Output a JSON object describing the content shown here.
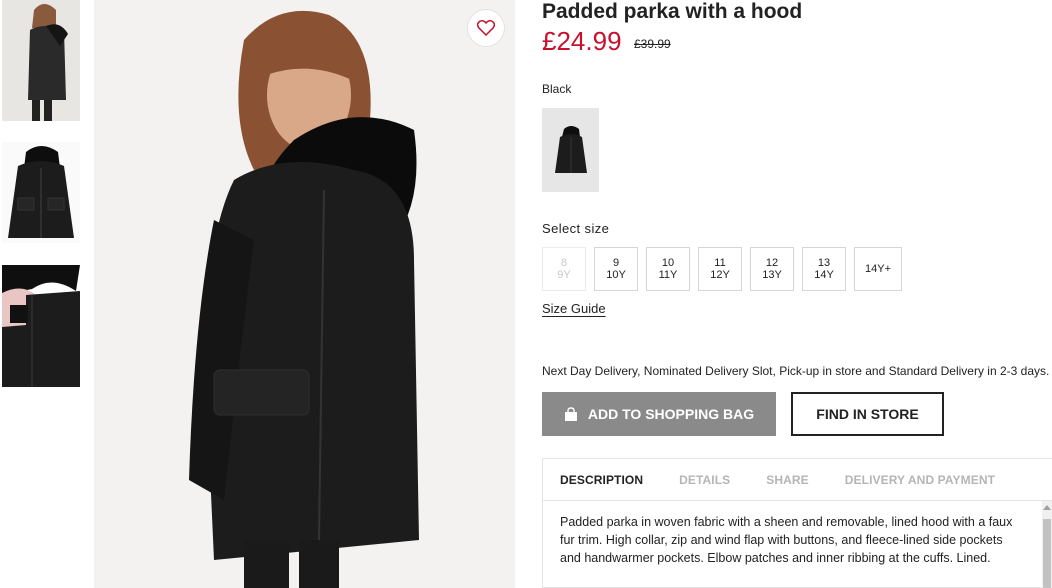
{
  "product": {
    "title": "Padded parka with a hood",
    "price": "£24.99",
    "old_price": "£39.99",
    "color_name": "Black",
    "select_size_label": "Select size",
    "sizes": [
      {
        "top": "8",
        "bottom": "9Y",
        "available": false
      },
      {
        "top": "9",
        "bottom": "10Y",
        "available": true
      },
      {
        "top": "10",
        "bottom": "11Y",
        "available": true
      },
      {
        "top": "11",
        "bottom": "12Y",
        "available": true
      },
      {
        "top": "12",
        "bottom": "13Y",
        "available": true
      },
      {
        "top": "13",
        "bottom": "14Y",
        "available": true
      },
      {
        "top": "14Y+",
        "bottom": "",
        "available": true
      }
    ],
    "size_guide": "Size Guide",
    "delivery_text": "Next Day Delivery, Nominated Delivery Slot, Pick-up in store and Standard Delivery in 2-3 days.",
    "add_to_bag": "ADD TO SHOPPING BAG",
    "find_in_store": "FIND IN STORE"
  },
  "tabs": [
    {
      "label": "DESCRIPTION",
      "active": true
    },
    {
      "label": "DETAILS",
      "active": false
    },
    {
      "label": "SHARE",
      "active": false
    },
    {
      "label": "DELIVERY AND PAYMENT",
      "active": false
    }
  ],
  "description": "Padded parka in woven fabric with a sheen and removable, lined hood with a faux fur trim. High collar, zip and wind flap with buttons, and fleece-lined side pockets and handwarmer pockets. Elbow patches and inner ribbing at the cuffs. Lined.",
  "colors": {
    "price_red": "#c8102e",
    "bag_button_bg": "#8a8a8a",
    "jacket": "#1c1c1c",
    "fav_heart": "#c8102e"
  },
  "icons": {
    "favorite": "heart-outline-icon",
    "bag": "shopping-bag-icon"
  }
}
